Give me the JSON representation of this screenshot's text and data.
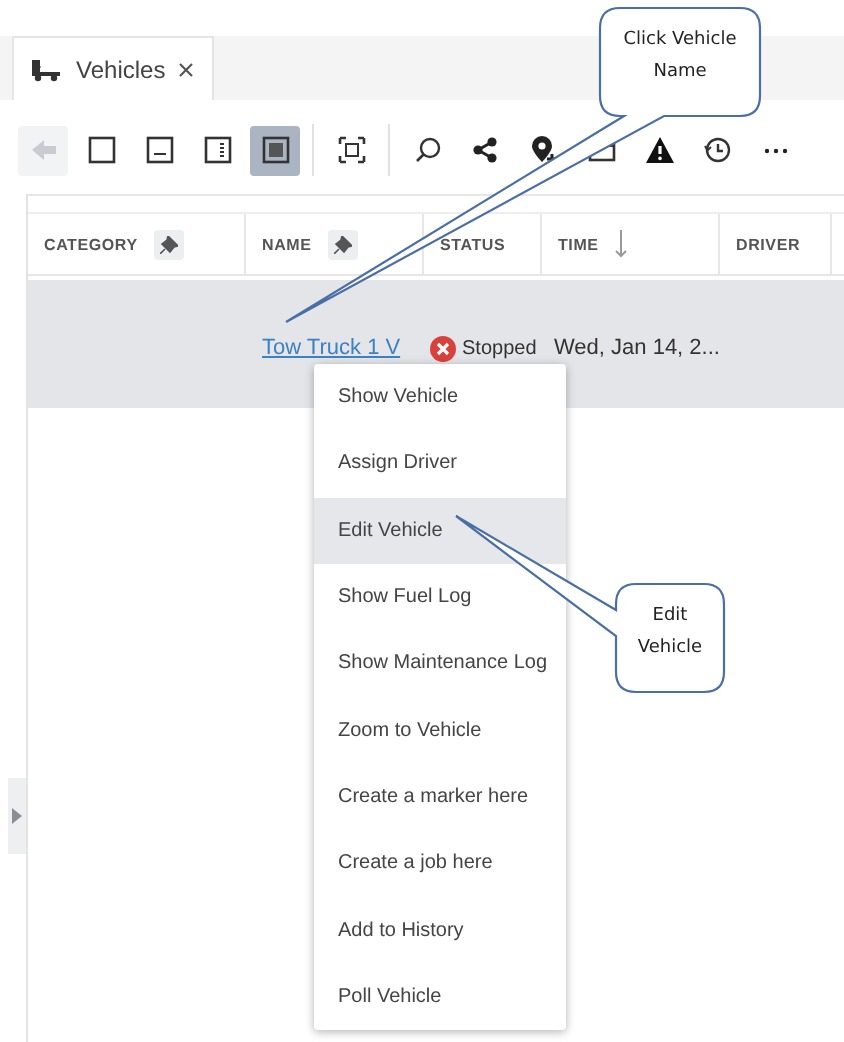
{
  "tabs": [
    {
      "label": "Vehicles",
      "selected": true
    }
  ],
  "toolbar": [
    {
      "kind": "back",
      "selected": false,
      "disabled": true
    },
    {
      "kind": "frame",
      "selected": false,
      "disabled": false
    },
    {
      "kind": "panel-bottom",
      "selected": false,
      "disabled": false
    },
    {
      "kind": "panel-right",
      "selected": false,
      "disabled": false
    },
    {
      "kind": "panel-full",
      "selected": true,
      "disabled": false
    },
    {
      "kind": "fit",
      "selected": false,
      "disabled": false
    },
    {
      "kind": "search",
      "selected": false,
      "disabled": false
    },
    {
      "kind": "share",
      "selected": false,
      "disabled": false
    },
    {
      "kind": "pin-plus",
      "selected": false,
      "disabled": false
    },
    {
      "kind": "window",
      "selected": false,
      "disabled": false
    },
    {
      "kind": "warning",
      "selected": false,
      "disabled": false
    },
    {
      "kind": "history",
      "selected": false,
      "disabled": false
    },
    {
      "kind": "more",
      "selected": false,
      "disabled": false
    }
  ],
  "table": {
    "columns": [
      {
        "label": "CATEGORY",
        "pinned": true,
        "sorted": false
      },
      {
        "label": "NAME",
        "pinned": true,
        "sorted": false
      },
      {
        "label": "STATUS",
        "pinned": false,
        "sorted": false
      },
      {
        "label": "TIME",
        "pinned": false,
        "sorted": true
      },
      {
        "label": "DRIVER",
        "pinned": false,
        "sorted": false
      }
    ],
    "rows": [
      {
        "selected": true,
        "name": "Tow Truck 1 V",
        "status": "Stopped",
        "time": "Wed, Jan 14, 2..."
      }
    ]
  },
  "context_menu": [
    {
      "label": "Show Vehicle",
      "selected": false
    },
    {
      "label": "Assign Driver",
      "selected": false
    },
    {
      "label": "Edit Vehicle",
      "selected": true
    },
    {
      "label": "Show Fuel Log",
      "selected": false
    },
    {
      "label": "Show Maintenance Log",
      "selected": false
    },
    {
      "label": "Zoom to Vehicle",
      "selected": false
    },
    {
      "label": "Create a marker here",
      "selected": false
    },
    {
      "label": "Create a job here",
      "selected": false
    },
    {
      "label": "Add to History",
      "selected": false
    },
    {
      "label": "Poll Vehicle",
      "selected": false
    }
  ],
  "callouts": [
    {
      "lines": [
        "Click Vehicle",
        "Name"
      ]
    },
    {
      "lines": [
        "Edit",
        "Vehicle"
      ]
    }
  ]
}
